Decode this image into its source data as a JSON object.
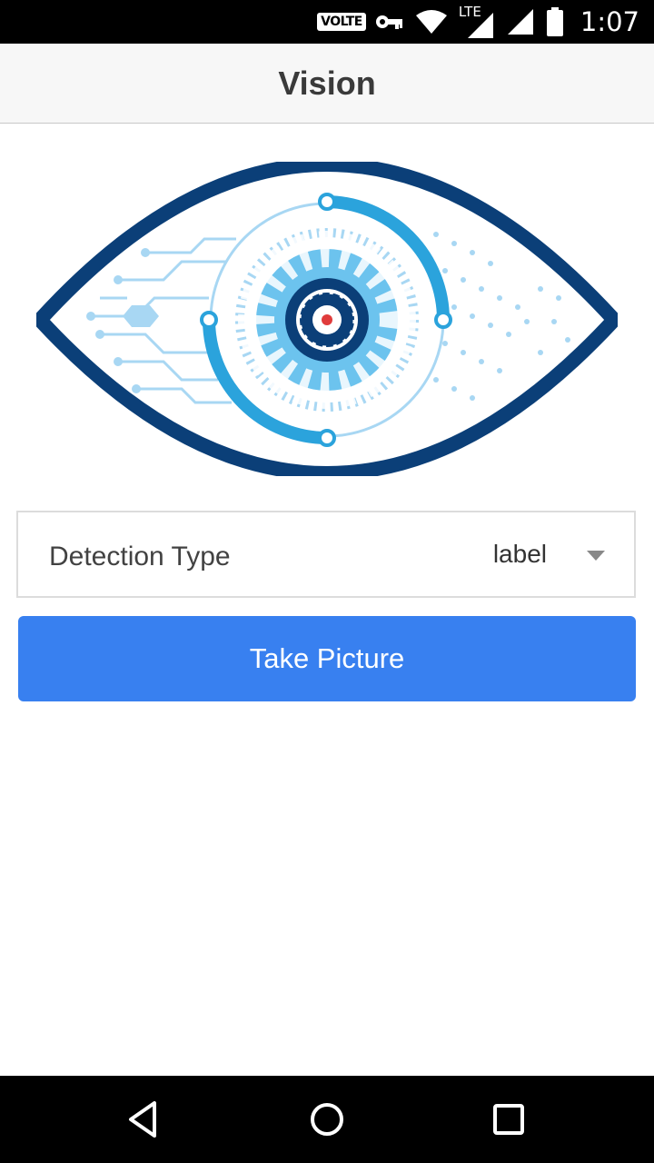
{
  "status_bar": {
    "network_badge": "VOLTE",
    "network_type": "LTE",
    "time": "1:07",
    "icons": [
      "vpn-key-icon",
      "wifi-icon",
      "signal-icon",
      "battery-icon"
    ]
  },
  "app_bar": {
    "title": "Vision"
  },
  "hero": {
    "icon": "eye-logo"
  },
  "detection": {
    "label": "Detection Type",
    "selected_value": "label"
  },
  "actions": {
    "take_picture_label": "Take Picture"
  },
  "nav_bar": {
    "icons": [
      "back-icon",
      "home-icon",
      "recents-icon"
    ]
  },
  "colors": {
    "primary_button": "#3880f0",
    "app_bar_bg": "#f7f7f7",
    "eye_dark_blue": "#0b3f78",
    "eye_light_blue": "#2ba3dc",
    "eye_pale_blue": "#a8d7f3",
    "pupil_red": "#e03c3c"
  }
}
